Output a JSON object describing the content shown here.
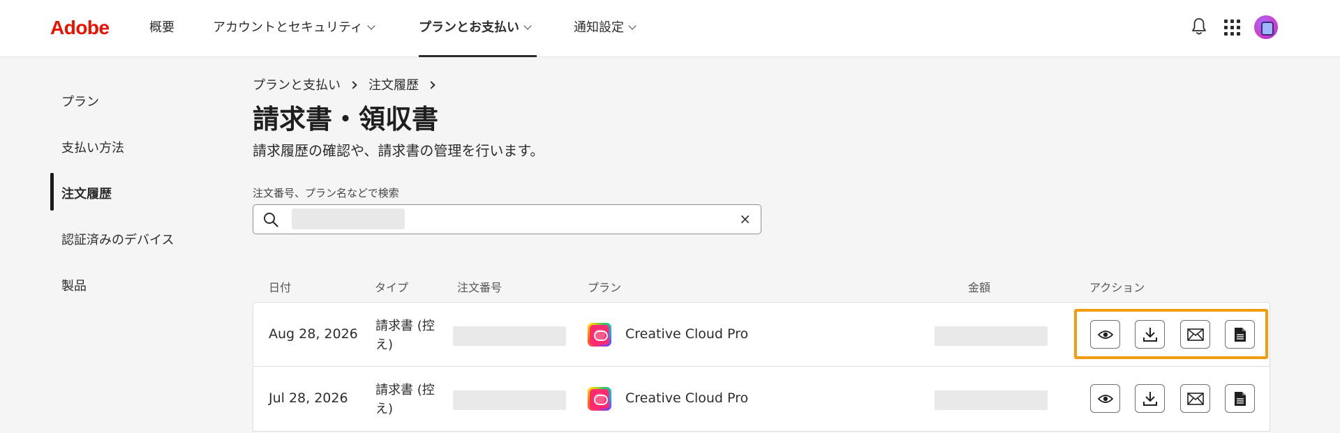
{
  "brand": {
    "logo_text": "Adobe",
    "accent": "#eb1000"
  },
  "nav": {
    "items": [
      {
        "label": "概要"
      },
      {
        "label": "アカウントとセキュリティ"
      },
      {
        "label": "プランとお支払い"
      },
      {
        "label": "通知設定"
      }
    ],
    "active_index": 2,
    "icons": [
      "bell-icon",
      "apps-grid-icon",
      "avatar"
    ]
  },
  "sidebar": {
    "items": [
      {
        "label": "プラン"
      },
      {
        "label": "支払い方法"
      },
      {
        "label": "注文履歴"
      },
      {
        "label": "認証済みのデバイス"
      },
      {
        "label": "製品"
      }
    ],
    "active_index": 2
  },
  "breadcrumb": {
    "items": [
      "プランと支払い",
      "注文履歴"
    ]
  },
  "page": {
    "title": "請求書・領収書",
    "description": "請求履歴の確認や、請求書の管理を行います。"
  },
  "search": {
    "label": "注文番号、プラン名などで検索",
    "value": "",
    "clear_glyph": "×"
  },
  "table": {
    "headers": {
      "date": "日付",
      "type": "タイプ",
      "order": "注文番号",
      "plan": "プラン",
      "amount": "金額",
      "actions": "アクション"
    },
    "rows": [
      {
        "date": "Aug 28, 2026",
        "type": "請求書 (控え)",
        "plan": "Creative Cloud Pro"
      },
      {
        "date": "Jul 28, 2026",
        "type": "請求書 (控え)",
        "plan": "Creative Cloud Pro"
      }
    ],
    "action_icons": [
      "eye-icon",
      "download-icon",
      "mail-icon",
      "document-icon"
    ],
    "highlight_color": "#f39c12"
  }
}
